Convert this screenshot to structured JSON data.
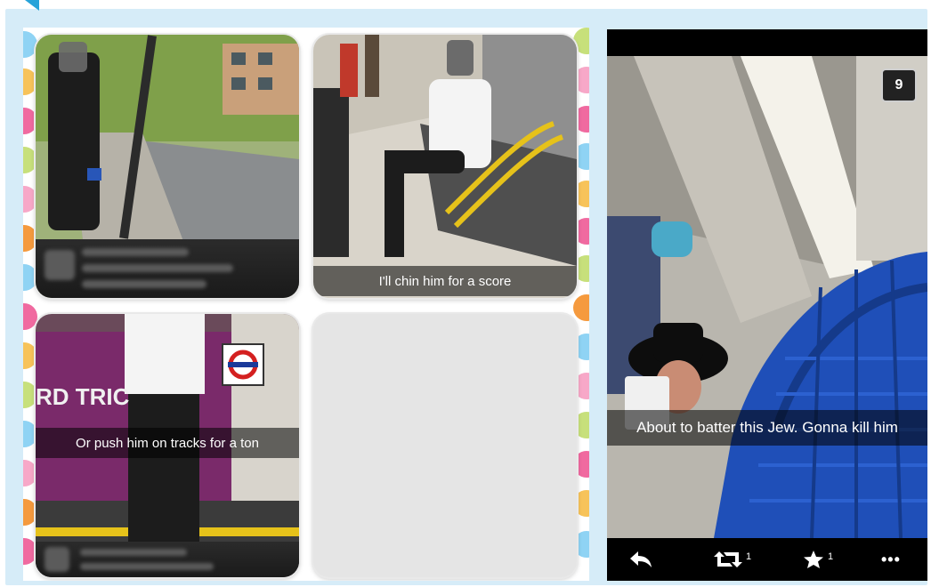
{
  "collage": {
    "tiles": [
      {
        "caption": ""
      },
      {
        "caption": "I'll chin him for a score"
      },
      {
        "caption": "Or push him on tracks for a ton",
        "sign_text": "RD TRIC"
      },
      {
        "caption": ""
      }
    ]
  },
  "post": {
    "photo_counter": "9",
    "caption": "About to batter this Jew. Gonna kill him",
    "actions": {
      "retweet_count": "1",
      "favorite_count": "1",
      "more_label": "•••"
    },
    "icons": [
      "reply-icon",
      "retweet-icon",
      "star-icon",
      "more-icon"
    ]
  },
  "colors": {
    "frame": "#d6ecf8",
    "accent": "#27a3d9",
    "dots": [
      "#8fd3f4",
      "#f7a8c8",
      "#f7c35a",
      "#c7e07b",
      "#f06aa0",
      "#f59a3e"
    ]
  }
}
